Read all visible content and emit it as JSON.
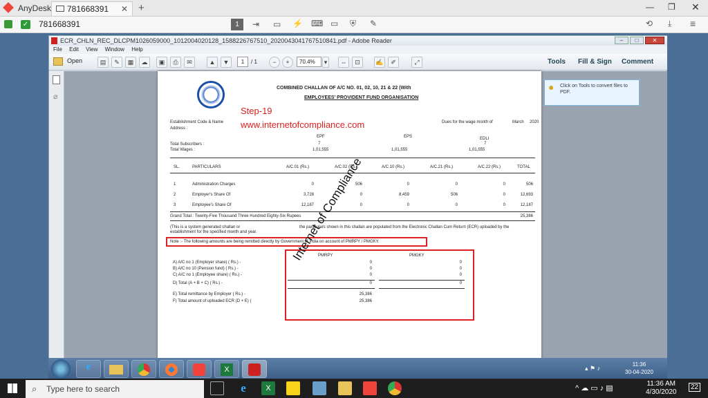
{
  "anydesk": {
    "app_name": "AnyDesk",
    "tab_id": "781668391",
    "address": "781668391"
  },
  "reader": {
    "window_title": "ECR_CHLN_REC_DLCPM1026059000_1012004020128_1588226767510_2020043041767510841.pdf - Adobe Reader",
    "menu": [
      "File",
      "Edit",
      "View",
      "Window",
      "Help"
    ],
    "open_label": "Open",
    "page_current": "1",
    "page_total": "/ 1",
    "zoom": "70.4%",
    "tools_tab": "Tools",
    "fill_sign_tab": "Fill & Sign",
    "comment_tab": "Comment",
    "tooltip": "Click on Tools to convert files to PDF."
  },
  "doc": {
    "title1": "COMBINED CHALLAN OF A/C NO. 01, 02, 10, 21 & 22 (With",
    "title2": "EMPLOYEES' PROVIDENT FUND ORGANISATION",
    "step": "Step-19",
    "site": "www.internetofcompliance.com",
    "watermark": "Internet of Compliance",
    "est_code": "Establishment Code & Name",
    "address": "Address :",
    "dues": "Dues for the wage month of",
    "month": "March",
    "year": "2020",
    "col_epf": "EPF",
    "col_eps": "EPS",
    "col_edli": "EDLI",
    "total_subscribers": "Total Subscribers :",
    "sub_epf": "7",
    "sub_edli": "7",
    "total_wages": "Total Wages :",
    "wage_epf": "1,01,555",
    "wage_eps": "1,01,555",
    "wage_edli": "1,01,555",
    "headers": [
      "SL.",
      "PARTICULARS",
      "A/C.01 (Rs.)",
      "A/C.02 (Rs.)",
      "A/C.10 (Rs.)",
      "A/C.21 (Rs.)",
      "A/C.22 (Rs.)",
      "TOTAL"
    ],
    "rows": [
      [
        "1",
        "Administration Charges",
        "0",
        "506",
        "0",
        "0",
        "0",
        "506"
      ],
      [
        "2",
        "Employer's Share Of",
        "3,728",
        "0",
        "8,459",
        "506",
        "0",
        "12,693"
      ],
      [
        "3",
        "Employee's Share Of",
        "12,187",
        "0",
        "0",
        "0",
        "0",
        "12,187"
      ]
    ],
    "grand_total": "Grand Total : Twenty-Five Thousand Three Hundred Eighty-Six Rupees",
    "grand_total_value": "25,386",
    "note_system1": "(This is a system generated challan or",
    "note_system2": "establishment for the specified month and year.",
    "note_system_right": "the particulars shown in this challan are populated from the Electronic Challan Cum Return (ECR) uploaded by the",
    "note_remit": "Note :- The following amounts are being remitted directly by Government of India on account of PMRPY / PMGKY.",
    "pmrpy": "PMRPY",
    "pmgky": "PMGKY",
    "lines": [
      {
        "label": "A)  A/C no 1 (Employer share) ( Rs.) -",
        "pmrpy": "0",
        "pmgky": "0"
      },
      {
        "label": "B)  A/C no 10 (Pension fund) ( Rs.) -",
        "pmrpy": "0",
        "pmgky": "0"
      },
      {
        "label": "C)  A/C no 1 (Employee share) ( Rs.) -",
        "pmrpy": "0",
        "pmgky": "0"
      },
      {
        "label": "D)  Total (A + B + C) ( Rs.) -",
        "pmrpy": "0",
        "pmgky": "0"
      },
      {
        "label": "E)  Total remittance by Employer ( Rs.) -",
        "pmrpy": "25,386",
        "pmgky": ""
      },
      {
        "label": "F)  Total amount of uploaded ECR (D + E) (",
        "pmrpy": "25,386",
        "pmgky": ""
      }
    ]
  },
  "win7clock": {
    "time": "11:36",
    "date": "30-04-2020"
  },
  "taskbar": {
    "search_placeholder": "Type here to search",
    "time": "11:36 AM",
    "date": "4/30/2020",
    "notif": "22"
  },
  "colors": {
    "highlight": "#e02020",
    "step": "#e02020"
  }
}
